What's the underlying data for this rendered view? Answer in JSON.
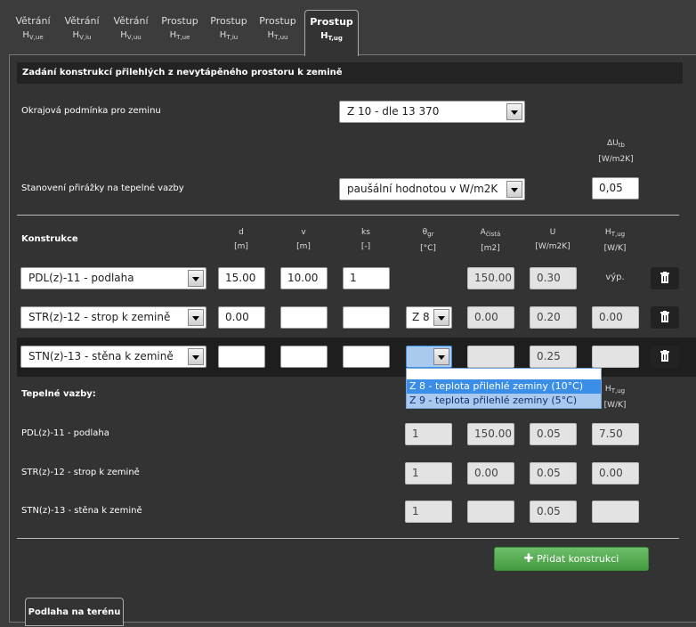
{
  "tabs": [
    {
      "line1": "Větrání",
      "sym": "H",
      "sub": "V,ue"
    },
    {
      "line1": "Větrání",
      "sym": "H",
      "sub": "V,iu"
    },
    {
      "line1": "Větrání",
      "sym": "H",
      "sub": "V,uu"
    },
    {
      "line1": "Prostup",
      "sym": "H",
      "sub": "T,ue"
    },
    {
      "line1": "Prostup",
      "sym": "H",
      "sub": "T,iu"
    },
    {
      "line1": "Prostup",
      "sym": "H",
      "sub": "T,uu"
    },
    {
      "line1": "Prostup",
      "sym": "H",
      "sub": "T,ug"
    }
  ],
  "section_title": "Zadání konstrukcí přilehlých z nevytápěného prostoru k zemině",
  "boundary": {
    "label": "Okrajová podmínka pro zeminu",
    "value": "Z 10 - dle 13 370"
  },
  "bridges": {
    "label": "Stanovení přirážky na tepelné vazby",
    "value": "paušální hodnotou v W/m2K",
    "delta_label": "ΔU",
    "delta_sub": "tb",
    "delta_unit": "[W/m2K]",
    "delta_value": "0,05"
  },
  "columns": {
    "construction": "Konstrukce",
    "d": {
      "name": "d",
      "unit": "[m]"
    },
    "v": {
      "name": "v",
      "unit": "[m]"
    },
    "ks": {
      "name": "ks",
      "unit": "[-]"
    },
    "theta": {
      "name": "θ",
      "sub": "gr",
      "unit": "[°C]"
    },
    "area": {
      "name": "A",
      "sub": "čistá",
      "unit": "[m2]"
    },
    "u": {
      "name": "U",
      "unit": "[W/m2K]"
    },
    "h": {
      "name": "H",
      "sub": "T,ug",
      "unit": "[W/K]"
    }
  },
  "rows": [
    {
      "construction": "PDL(z)-11 - podlaha",
      "d": "15.00",
      "v": "10.00",
      "ks": "1",
      "theta": "",
      "area": "150.00",
      "u": "0.30",
      "h": "výp."
    },
    {
      "construction": "STR(z)-12 - strop k zemině",
      "d": "0.00",
      "v": "",
      "ks": "",
      "theta": "Z 8",
      "area": "0.00",
      "u": "0.20",
      "h": "0.00"
    },
    {
      "construction": "STN(z)-13 - stěna k zemině",
      "d": "",
      "v": "",
      "ks": "",
      "theta": "",
      "area": "",
      "u": "0.25",
      "h": ""
    }
  ],
  "dropdown_options": [
    "Z 8 - teplota přilehlé zeminy (10°C)",
    "Z 9 - teplota přilehlé zeminy (5°C)"
  ],
  "thermal": {
    "label": "Tepelné vazby:",
    "h_label": "H",
    "h_sub": "T,ug",
    "h_unit": "[W/K]",
    "rows": [
      {
        "name": "PDL(z)-11 - podlaha",
        "ks": "1",
        "area": "150.00",
        "u": "0.05",
        "h": "7.50"
      },
      {
        "name": "STR(z)-12 - strop k zemině",
        "ks": "1",
        "area": "0.00",
        "u": "0.05",
        "h": "0.00"
      },
      {
        "name": "STN(z)-13 - stěna k zemině",
        "ks": "1",
        "area": "",
        "u": "0.05",
        "h": ""
      }
    ]
  },
  "add_button": "Přidat konstrukci",
  "bottom_tab": "Podlaha na terénu"
}
